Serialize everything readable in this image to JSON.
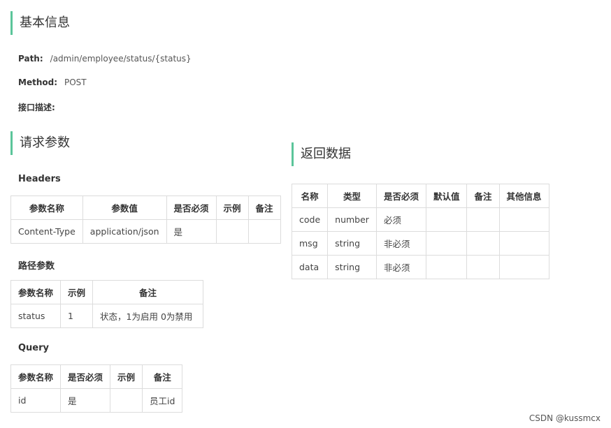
{
  "basic": {
    "title": "基本信息",
    "path_label": "Path:",
    "path_value": "/admin/employee/status/{status}",
    "method_label": "Method:",
    "method_value": "POST",
    "desc_label": "接口描述:"
  },
  "request": {
    "title": "请求参数",
    "headers": {
      "title": "Headers",
      "columns": [
        "参数名称",
        "参数值",
        "是否必须",
        "示例",
        "备注"
      ],
      "rows": [
        [
          "Content-Type",
          "application/json",
          "是",
          "",
          ""
        ]
      ]
    },
    "path_params": {
      "title": "路径参数",
      "columns": [
        "参数名称",
        "示例",
        "备注"
      ],
      "rows": [
        [
          "status",
          "1",
          "状态，1为启用 0为禁用"
        ]
      ]
    },
    "query": {
      "title": "Query",
      "columns": [
        "参数名称",
        "是否必须",
        "示例",
        "备注"
      ],
      "rows": [
        [
          "id",
          "是",
          "",
          "员工id"
        ]
      ]
    }
  },
  "response": {
    "title": "返回数据",
    "columns": [
      "名称",
      "类型",
      "是否必须",
      "默认值",
      "备注",
      "其他信息"
    ],
    "rows": [
      [
        "code",
        "number",
        "必须",
        "",
        "",
        ""
      ],
      [
        "msg",
        "string",
        "非必须",
        "",
        "",
        ""
      ],
      [
        "data",
        "string",
        "非必须",
        "",
        "",
        ""
      ]
    ]
  },
  "watermark": "CSDN @kussmcx"
}
